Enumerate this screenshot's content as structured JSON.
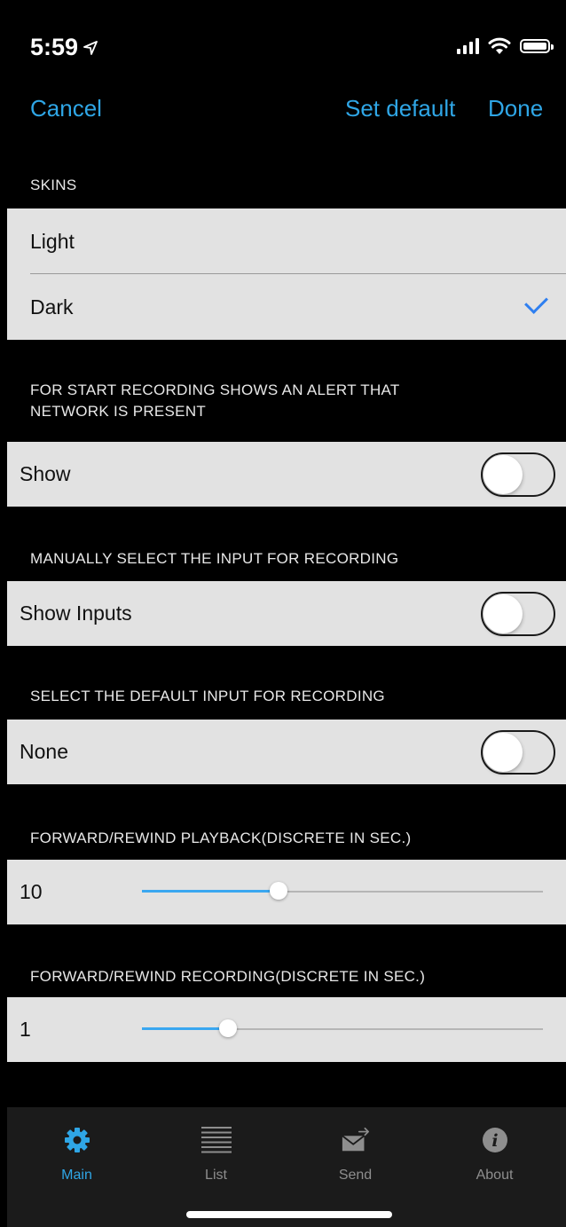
{
  "status_bar": {
    "time": "5:59",
    "location_arrow": "location-arrow-icon"
  },
  "nav": {
    "cancel": "Cancel",
    "set_default": "Set default",
    "done": "Done"
  },
  "colors": {
    "accent": "#2fa6e6",
    "check": "#2f7ff0",
    "cell_bg": "#e2e2e2",
    "background": "#000000",
    "tabbar_bg": "#1b1b1b"
  },
  "skins": {
    "header": "SKINS",
    "options": [
      {
        "label": "Light",
        "selected": false
      },
      {
        "label": "Dark",
        "selected": true
      }
    ]
  },
  "network_alert": {
    "header_line1": "FOR START RECORDING SHOWS AN ALERT THAT",
    "header_line2": "NETWORK IS PRESENT",
    "label": "Show",
    "on": false
  },
  "manual_input": {
    "header": "MANUALLY SELECT THE INPUT FOR RECORDING",
    "label": "Show Inputs",
    "on": false
  },
  "default_input": {
    "header": "SELECT THE DEFAULT INPUT FOR RECORDING",
    "label": "None",
    "on": false
  },
  "playback_step": {
    "header": "FORWARD/REWIND PLAYBACK(DISCRETE IN SEC.)",
    "value": "10",
    "fraction": 0.34
  },
  "recording_step": {
    "header": "FORWARD/REWIND RECORDING(DISCRETE IN SEC.)",
    "value": "1",
    "fraction": 0.215
  },
  "tabs": [
    {
      "label": "Main",
      "icon": "gear-icon",
      "active": true
    },
    {
      "label": "List",
      "icon": "list-icon",
      "active": false
    },
    {
      "label": "Send",
      "icon": "send-mail-icon",
      "active": false
    },
    {
      "label": "About",
      "icon": "info-icon",
      "active": false
    }
  ]
}
